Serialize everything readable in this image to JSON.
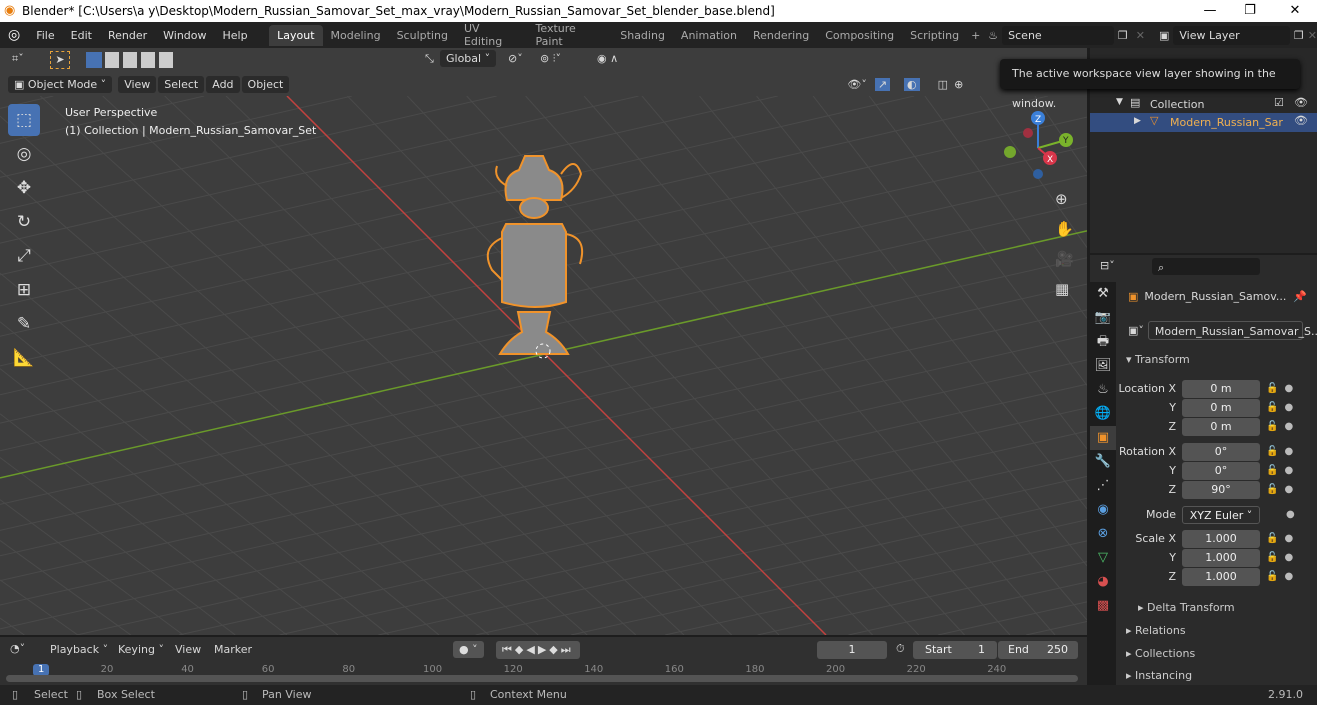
{
  "window": {
    "title": "Blender* [C:\\Users\\a y\\Desktop\\Modern_Russian_Samovar_Set_max_vray\\Modern_Russian_Samovar_Set_blender_base.blend]"
  },
  "menu": [
    "File",
    "Edit",
    "Render",
    "Window",
    "Help"
  ],
  "workspaces": [
    "Layout",
    "Modeling",
    "Sculpting",
    "UV Editing",
    "Texture Paint",
    "Shading",
    "Animation",
    "Rendering",
    "Compositing",
    "Scripting"
  ],
  "scene": "Scene",
  "view_layer": "View Layer",
  "tool_header": {
    "orientation": "Global"
  },
  "viewport_header": {
    "mode": "Object Mode",
    "menus": [
      "View",
      "Select",
      "Add",
      "Object"
    ]
  },
  "viewport": {
    "perspective": "User Perspective",
    "collection_info": "(1) Collection | Modern_Russian_Samovar_Set",
    "colors": {
      "x_axis": "#c2423f",
      "y_axis": "#6a9a2a",
      "selection": "#f0932b"
    },
    "gizmo": {
      "x": "X",
      "y": "Y",
      "z": "Z"
    }
  },
  "tooltip": "The active workspace view layer showing in the window.",
  "outliner": {
    "collection": "Collection",
    "object": "Modern_Russian_Sar"
  },
  "properties": {
    "object_name": "Modern_Russian_Samov...",
    "data_name": "Modern_Russian_Samovar_S...",
    "transform_label": "Transform",
    "location": {
      "label": "Location X",
      "x": "0 m",
      "y": "0 m",
      "z": "0 m"
    },
    "rotation": {
      "label": "Rotation X",
      "x": "0°",
      "y": "0°",
      "z": "90°"
    },
    "mode_label": "Mode",
    "mode": "XYZ Euler",
    "scale": {
      "label": "Scale X",
      "x": "1.000",
      "y": "1.000",
      "z": "1.000"
    },
    "axis_y": "Y",
    "axis_z": "Z",
    "sections": [
      "Delta Transform",
      "Relations",
      "Collections",
      "Instancing"
    ]
  },
  "timeline": {
    "menus": [
      "Playback",
      "Keying",
      "View",
      "Marker"
    ],
    "current_frame": "1",
    "start_label": "Start",
    "start": "1",
    "end_label": "End",
    "end": "250",
    "ticks": [
      "1",
      "20",
      "40",
      "60",
      "80",
      "100",
      "120",
      "140",
      "160",
      "180",
      "200",
      "220",
      "240"
    ]
  },
  "status": {
    "select": "Select",
    "box_select": "Box Select",
    "pan_view": "Pan View",
    "context_menu": "Context Menu",
    "version": "2.91.0"
  }
}
